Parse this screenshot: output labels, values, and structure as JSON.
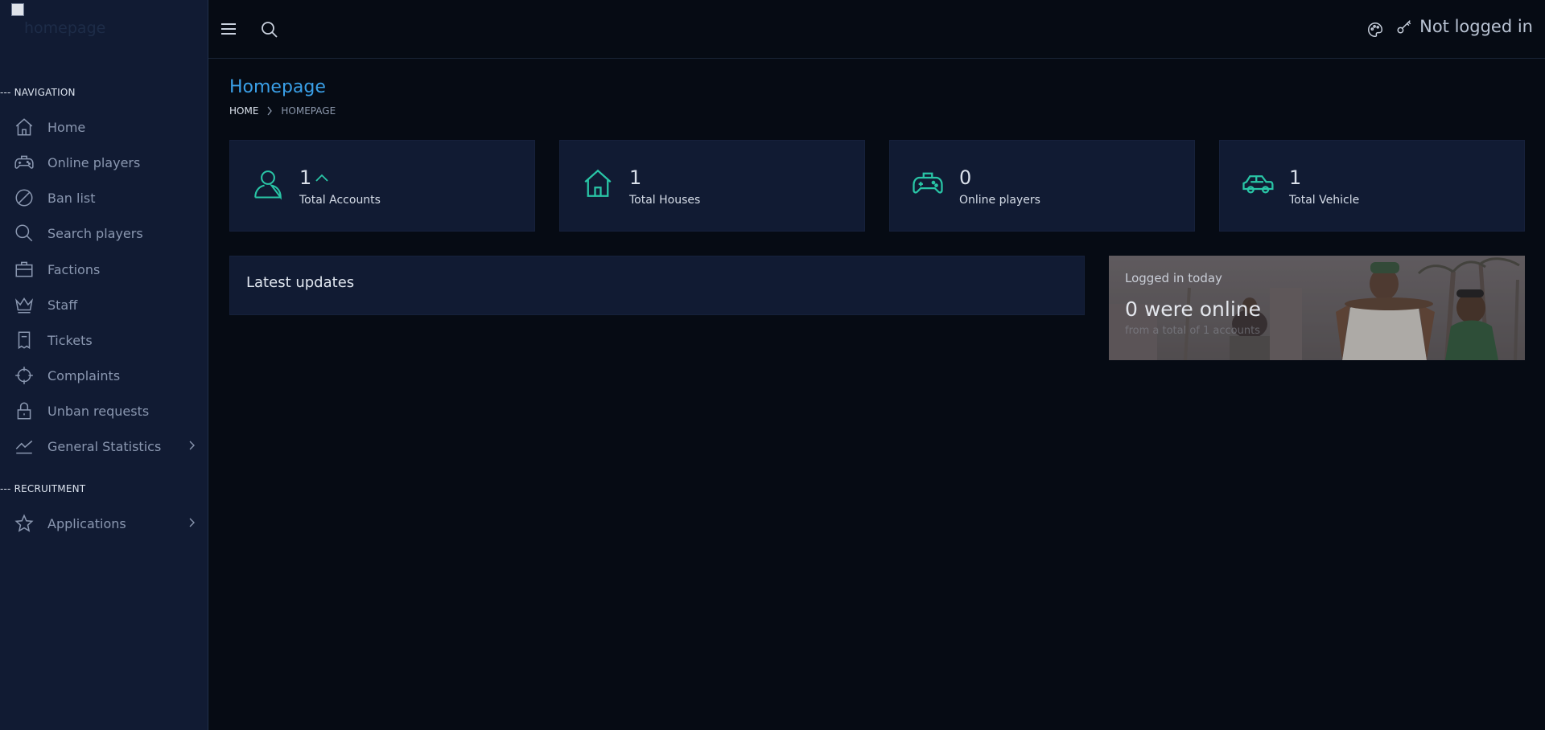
{
  "logo": {
    "alt_text": "homepage"
  },
  "sidebar": {
    "sections": [
      {
        "header": "--- NAVIGATION",
        "items": [
          {
            "label": "Home",
            "icon": "home-icon"
          },
          {
            "label": "Online players",
            "icon": "gamepad-icon"
          },
          {
            "label": "Ban list",
            "icon": "ban-icon"
          },
          {
            "label": "Search players",
            "icon": "search-icon"
          },
          {
            "label": "Factions",
            "icon": "briefcase-icon"
          },
          {
            "label": "Staff",
            "icon": "crown-icon"
          },
          {
            "label": "Tickets",
            "icon": "ticket-icon"
          },
          {
            "label": "Complaints",
            "icon": "crosshair-icon"
          },
          {
            "label": "Unban requests",
            "icon": "lock-icon"
          },
          {
            "label": "General Statistics",
            "icon": "chart-line-icon",
            "has_submenu": true
          }
        ]
      },
      {
        "header": "--- RECRUITMENT",
        "items": [
          {
            "label": "Applications",
            "icon": "star-icon",
            "has_submenu": true
          }
        ]
      }
    ]
  },
  "topbar": {
    "menu_icon": "hamburger-icon",
    "search_icon": "search-icon",
    "theme_icon": "palette-icon",
    "login": {
      "icon": "key-icon",
      "label": "Not logged in"
    }
  },
  "page": {
    "title": "Homepage",
    "breadcrumb": {
      "home": "HOME",
      "current": "HOMEPAGE"
    }
  },
  "stats": [
    {
      "value": "1",
      "label": "Total Accounts",
      "icon": "user-icon",
      "trend": "up"
    },
    {
      "value": "1",
      "label": "Total Houses",
      "icon": "house-icon"
    },
    {
      "value": "0",
      "label": "Online players",
      "icon": "gamepad-icon"
    },
    {
      "value": "1",
      "label": "Total Vehicle",
      "icon": "car-icon"
    }
  ],
  "updates": {
    "title": "Latest updates"
  },
  "today": {
    "title": "Logged in today",
    "headline": "0 were online",
    "subtitle": "from a total of 1 accounts"
  },
  "colors": {
    "accent_teal": "#29c5a6",
    "title_blue": "#3aa0e8",
    "sidebar_bg": "#111b33",
    "page_bg": "#060b14"
  }
}
